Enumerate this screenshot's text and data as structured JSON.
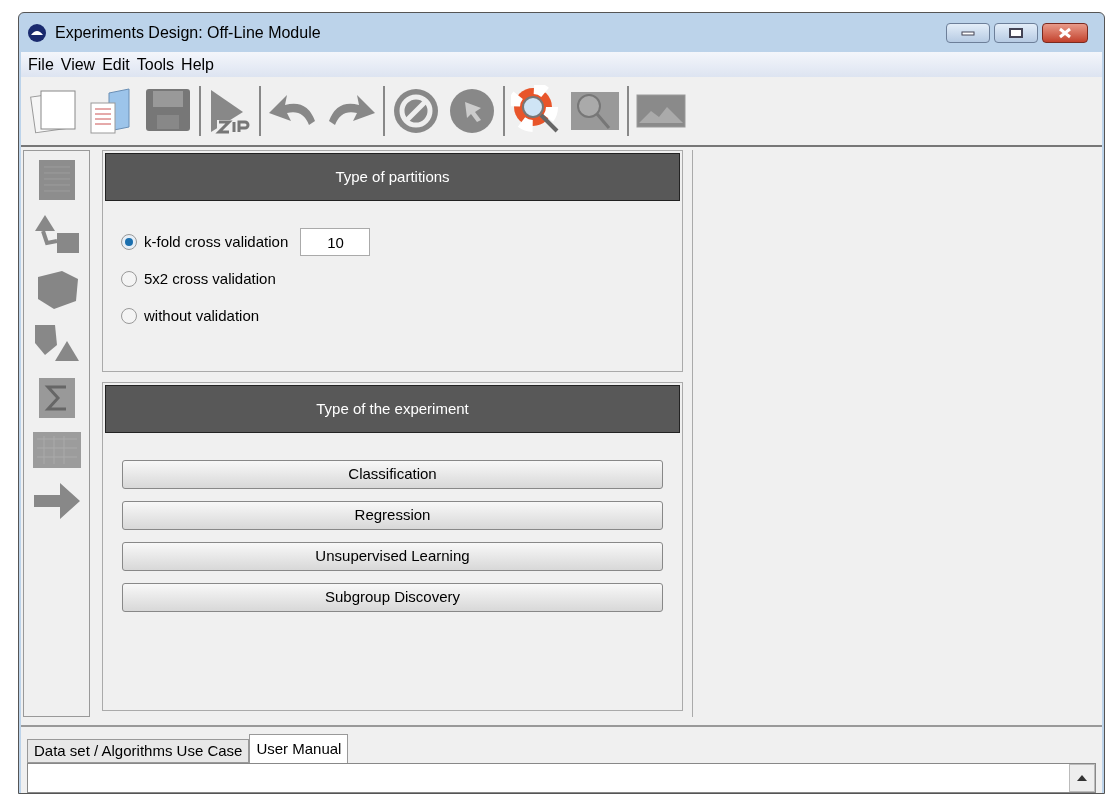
{
  "window": {
    "title": "Experiments Design: Off-Line Module"
  },
  "menu": [
    "File",
    "View",
    "Edit",
    "Tools",
    "Help"
  ],
  "partitions": {
    "title": "Type of partitions",
    "options": [
      {
        "label": "k-fold cross validation",
        "selected": true,
        "value": "10"
      },
      {
        "label": "5x2 cross validation",
        "selected": false
      },
      {
        "label": "without validation",
        "selected": false
      }
    ]
  },
  "experiment": {
    "title": "Type of the experiment",
    "buttons": [
      "Classification",
      "Regression",
      "Unsupervised Learning",
      "Subgroup Discovery"
    ]
  },
  "tabs": [
    {
      "label": "Data set / Algorithms Use Case",
      "selected": false
    },
    {
      "label": "User Manual",
      "selected": true
    }
  ]
}
